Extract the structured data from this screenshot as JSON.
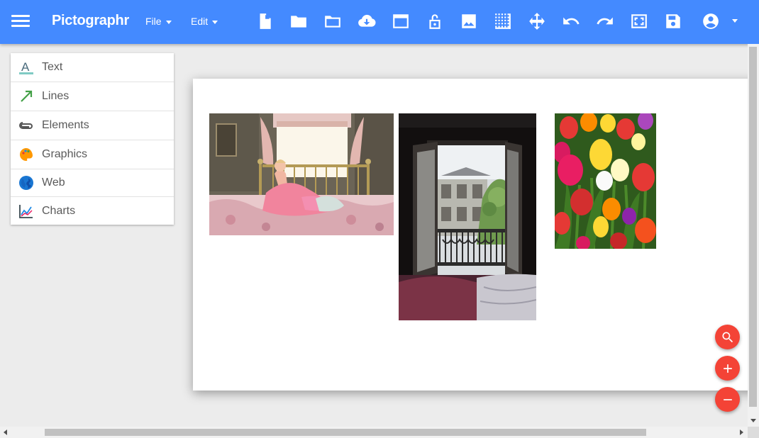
{
  "app": {
    "title": "Pictographr",
    "menus": [
      {
        "label": "File"
      },
      {
        "label": "Edit"
      }
    ],
    "toolbar_icons": [
      "new-document-icon",
      "open-folder-icon",
      "folder-outline-icon",
      "cloud-download-icon",
      "window-icon",
      "lock-open-icon",
      "image-icon",
      "grid-icon",
      "move-arrows-icon",
      "undo-icon",
      "redo-icon",
      "fit-screen-icon",
      "save-icon",
      "account-circle-icon"
    ],
    "accent_color": "#448aff",
    "fab_color": "#f44336"
  },
  "side_panel": {
    "items": [
      {
        "label": "Text",
        "icon": "text-a-icon"
      },
      {
        "label": "Lines",
        "icon": "arrow-line-icon"
      },
      {
        "label": "Elements",
        "icon": "paperclip-icon"
      },
      {
        "label": "Graphics",
        "icon": "palette-icon"
      },
      {
        "label": "Web",
        "icon": "globe-icon"
      },
      {
        "label": "Charts",
        "icon": "line-chart-icon"
      }
    ]
  },
  "canvas": {
    "images": [
      {
        "name": "woman-on-bed-photo"
      },
      {
        "name": "paris-window-photo"
      },
      {
        "name": "tulips-photo"
      }
    ]
  },
  "zoom_controls": [
    "zoom-search-icon",
    "zoom-in-icon",
    "zoom-out-icon"
  ]
}
